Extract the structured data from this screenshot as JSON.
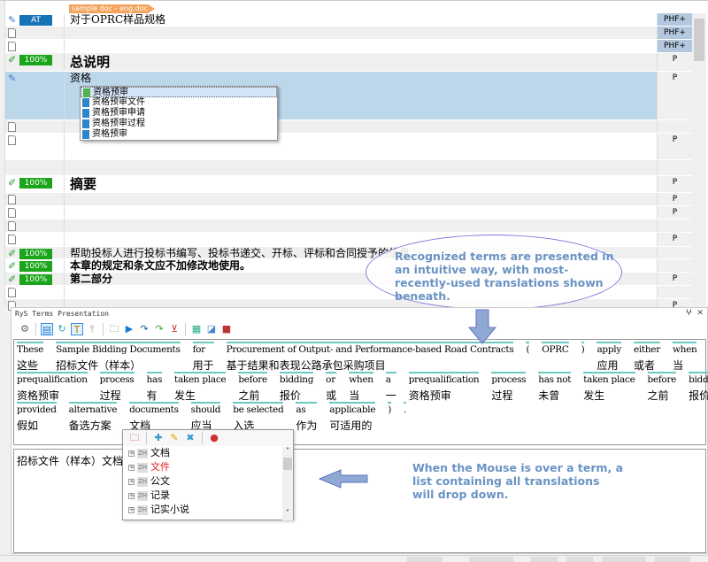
{
  "editor": {
    "doc_tag": "sample doc - eng.doc",
    "rows": [
      {
        "icon": "pencil",
        "badge": "AT",
        "badge_color": "#1673b8",
        "text": "对于OPRC样品规格",
        "status": "PHF+",
        "style": "normal"
      },
      {
        "icon": "doc",
        "badge": "",
        "text": "",
        "status": "PHF+"
      },
      {
        "icon": "doc",
        "badge": "",
        "text": "",
        "status": "PHF+"
      },
      {
        "icon": "check-pencil",
        "badge": "100%",
        "badge_color": "#1aa51a",
        "text": "总说明",
        "status": "P",
        "style": "heading"
      },
      {
        "icon": "pencil",
        "badge": "",
        "text": "资格",
        "status": "P",
        "style": "normal",
        "selected": true
      },
      {
        "icon": "doc",
        "badge": "",
        "text": "",
        "status": ""
      },
      {
        "icon": "doc",
        "badge": "",
        "text": "",
        "status": "P"
      },
      {
        "icon": "",
        "badge": "",
        "text": "",
        "status": ""
      },
      {
        "icon": "check-pencil",
        "badge": "100%",
        "badge_color": "#1aa51a",
        "text": "摘要",
        "status": "P",
        "style": "heading"
      },
      {
        "icon": "doc",
        "badge": "",
        "text": "",
        "status": "P"
      },
      {
        "icon": "doc",
        "badge": "",
        "text": "",
        "status": "P"
      },
      {
        "icon": "doc",
        "badge": "",
        "text": "",
        "status": ""
      },
      {
        "icon": "doc",
        "badge": "",
        "text": "",
        "status": "P"
      },
      {
        "icon": "check-pencil",
        "badge": "100%",
        "badge_color": "#1aa51a",
        "text": "帮助投标人进行投标书编写、投标书递交、开标、评标和合同授予的信息。",
        "status": "",
        "style": "normal"
      },
      {
        "icon": "check-pencil",
        "badge": "100%",
        "badge_color": "#1aa51a",
        "text": "本章的规定和条文应不加修改地使用。",
        "status": "",
        "style": "bold"
      },
      {
        "icon": "check-pencil",
        "badge": "100%",
        "badge_color": "#1aa51a",
        "text": "第二部分",
        "status": "P",
        "style": "bold"
      },
      {
        "icon": "doc",
        "badge": "",
        "text": "",
        "status": ""
      },
      {
        "icon": "doc",
        "badge": "",
        "text": "",
        "status": "P"
      }
    ],
    "autocomplete": [
      "资格预审",
      "资格预审文件",
      "资格预审申请",
      "资格预审过程",
      "资格预审"
    ]
  },
  "callouts": {
    "top": "Recognized terms are presented in an intuitive way, with most-recently-used translations shown beneath.",
    "bottom": "When the Mouse is over a term, a list containing all translations will drop down."
  },
  "panel": {
    "title": "RyS Terms Presentation",
    "pin": "ⵖ",
    "close": "✕",
    "lines": [
      [
        {
          "en": "These",
          "zh": "这些"
        },
        {
          "en": "Sample Bidding Documents",
          "zh": "招标文件（样本）"
        },
        {
          "en": "for",
          "zh": "用于"
        },
        {
          "en": "Procurement of Output- and Performance-based Road Contracts",
          "zh": "基于结果和表现公路承包采购项目"
        },
        {
          "en": "(",
          "zh": ""
        },
        {
          "en": "OPRC",
          "zh": ""
        },
        {
          "en": ")",
          "zh": ""
        },
        {
          "en": "apply",
          "zh": "应用"
        },
        {
          "en": "either",
          "zh": "或者"
        },
        {
          "en": "when",
          "zh": "当"
        },
        {
          "en": "a",
          "zh": "一"
        }
      ],
      [
        {
          "en": "prequalification",
          "zh": "资格预审"
        },
        {
          "en": "process",
          "zh": "过程"
        },
        {
          "en": "has",
          "zh": "有"
        },
        {
          "en": "taken place",
          "zh": "发生"
        },
        {
          "en": "before",
          "zh": "之前"
        },
        {
          "en": "bidding",
          "zh": "报价"
        },
        {
          "en": "or",
          "zh": "或"
        },
        {
          "en": "when",
          "zh": "当"
        },
        {
          "en": "a",
          "zh": "一"
        },
        {
          "en": "prequalification",
          "zh": "资格预审"
        },
        {
          "en": "process",
          "zh": "过程"
        },
        {
          "en": "has not",
          "zh": "未曾"
        },
        {
          "en": "taken place",
          "zh": "发生"
        },
        {
          "en": "before",
          "zh": "之前"
        },
        {
          "en": "bidding",
          "zh": "报价"
        },
        {
          "en": "(",
          "zh": ""
        }
      ],
      [
        {
          "en": "provided",
          "zh": "假如"
        },
        {
          "en": "alternative",
          "zh": "备选方案"
        },
        {
          "en": "documents",
          "zh": "文档"
        },
        {
          "en": "should",
          "zh": "应当"
        },
        {
          "en": "be selected",
          "zh": "入选"
        },
        {
          "en": "as",
          "zh": "作为"
        },
        {
          "en": "applicable",
          "zh": "可适用的"
        },
        {
          "en": ")",
          "zh": ""
        },
        {
          "en": ".",
          "zh": ""
        }
      ]
    ],
    "target_text": "招标文件（样本）文档",
    "dropdown": {
      "lang": "ZH",
      "items": [
        {
          "text": "文档",
          "color": "#000"
        },
        {
          "text": "文件",
          "color": "#e02020"
        },
        {
          "text": "公文",
          "color": "#000"
        },
        {
          "text": "记录",
          "color": "#000"
        },
        {
          "text": "记实小说",
          "color": "#000"
        }
      ]
    }
  }
}
